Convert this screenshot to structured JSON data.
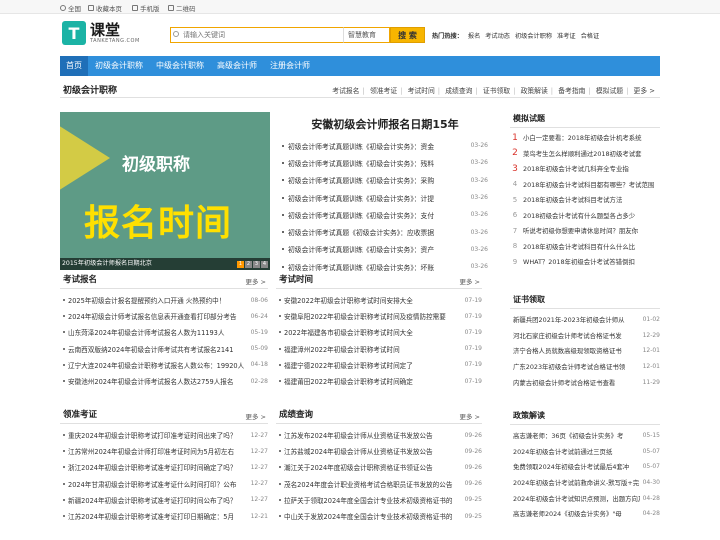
{
  "topbar": {
    "site": "全国",
    "fav": "收藏本页",
    "mobile": "手机版",
    "qr": "二维码"
  },
  "logo": {
    "cn": "课堂",
    "en": "TANKETANG.COM",
    "mark": "T"
  },
  "search": {
    "placeholder": "请输入关键词",
    "select": "智慧教育",
    "button": "搜 索"
  },
  "hot": {
    "label": "热门",
    "suffix": "热搜：",
    "items": [
      "报名",
      "考试动态",
      "初级会计职称",
      "准考证",
      "合格证"
    ]
  },
  "nav": [
    "首页",
    "初级会计职称",
    "中级会计职称",
    "高级会计师",
    "注册会计师"
  ],
  "sub": {
    "title": "初级会计职称",
    "links": [
      "考试报名",
      "领准考证",
      "考试时间",
      "成绩查询",
      "证书领取",
      "政策解读",
      "备考指南",
      "模拟试题",
      "更多 >"
    ]
  },
  "banner": {
    "line1": "初级职称",
    "line2": "报名时间",
    "caption": "2015年初级会计师报名日期北京",
    "dots": [
      "1",
      "2",
      "3",
      "4"
    ]
  },
  "headline": "安徽初级会计师报名日期15年",
  "hl": [
    {
      "t": "初级会计师考试真题训练《初级会计实务》：资金",
      "d": "03-26"
    },
    {
      "t": "初级会计师考试真题训练《初级会计实务》：残料",
      "d": "03-26"
    },
    {
      "t": "初级会计师考试真题训练《初级会计实务》：采购",
      "d": "03-26"
    },
    {
      "t": "初级会计师考试真题训练《初级会计实务》：计提",
      "d": "03-26"
    },
    {
      "t": "初级会计师考试真题训练《初级会计实务》：支付",
      "d": "03-26"
    },
    {
      "t": "初级会计师考试真题《初级会计实务》：应收票据",
      "d": "03-26"
    },
    {
      "t": "初级会计师考试真题训练《初级会计实务》：资产",
      "d": "03-26"
    },
    {
      "t": "初级会计师考试真题训练《初级会计实务》：坏账",
      "d": "03-26"
    }
  ],
  "sec1": {
    "title": "考试报名",
    "more": "更多 >",
    "items": [
      {
        "t": "2025年初级会计报名提醒预约入口开通 火热预约中！",
        "d": "08-06"
      },
      {
        "t": "2024年初级会计师考试报名信息表开通查看打印部分考告",
        "d": "06-24"
      },
      {
        "t": "山东菏泽2024年初级会计师考试报名人数为11193人",
        "d": "05-19"
      },
      {
        "t": "云南西双版纳2024年初级会计师考试共有考试报名2141",
        "d": "05-09"
      },
      {
        "t": "辽宁大连2024年初级会计职称考试报名人数公布：19920人",
        "d": "04-18"
      },
      {
        "t": "安徽池州2024年初级会计师考试报名人数达2759人报名",
        "d": "02-28"
      }
    ]
  },
  "sec2": {
    "title": "考试时间",
    "more": "更多 >",
    "items": [
      {
        "t": "安徽2022年初级会计职称考试时间安排大全",
        "d": "07-19"
      },
      {
        "t": "安徽阜阳2022年初级会计职称考试时间及疫情防控需要",
        "d": "07-19"
      },
      {
        "t": "2022年福建各市初级会计职称考试时间大全",
        "d": "07-19"
      },
      {
        "t": "福建漳州2022年初级会计职称考试时间",
        "d": "07-19"
      },
      {
        "t": "福建宁德2022年初级会计职称考试时间定了",
        "d": "07-19"
      },
      {
        "t": "福建莆田2022年初级会计职称考试时间确定",
        "d": "07-19"
      }
    ]
  },
  "sec3": {
    "title": "领准考证",
    "more": "更多 >",
    "items": [
      {
        "t": "重庆2024年初级会计职称考试打印准考证时间出来了吗？",
        "d": "12-27"
      },
      {
        "t": "江苏常州2024年初级会计师打印准考证时间为5月初左右",
        "d": "12-27"
      },
      {
        "t": "浙江2024年初级会计职称考试准考证打印时间确定了吗？",
        "d": "12-27"
      },
      {
        "t": "2024年甘肃初级会计职称考试准考证什么时间打印？公布",
        "d": "12-27"
      },
      {
        "t": "新疆2024年初级会计职称考试准考证打印时间公布了吗？",
        "d": "12-27"
      },
      {
        "t": "江苏2024年初级会计职称考试准考证打印日期确定：5月",
        "d": "12-21"
      }
    ]
  },
  "sec4": {
    "title": "成绩查询",
    "more": "更多 >",
    "items": [
      {
        "t": "江苏发布2024年初级会计师从业资格证书发放公告",
        "d": "09-26"
      },
      {
        "t": "江苏盐城2024年初级会计师从业资格证书发放公告",
        "d": "09-26"
      },
      {
        "t": "潮江关于2024年度初级会计职称资格证书领证公告",
        "d": "09-26"
      },
      {
        "t": "茂名2024年度会计职业资格考试合格职员证书发放的公告",
        "d": "09-26"
      },
      {
        "t": "拉萨关于领取2024年度全国会计专业技术初级资格证书的",
        "d": "09-25"
      },
      {
        "t": "中山关于发放2024年度全国会计专业技术初级资格证书的",
        "d": "09-25"
      }
    ]
  },
  "rank": {
    "title": "模拟试题",
    "items": [
      {
        "n": "1",
        "t": "小白一定要看：2018年初级会计机考系统"
      },
      {
        "n": "2",
        "t": "菜鸟考生怎么样顺利通过2018初级考试套"
      },
      {
        "n": "3",
        "t": "2018年初级会计考试几科弃全专业指"
      },
      {
        "n": "4",
        "t": "2018年初级会计考试科目都有哪些？考试范围"
      },
      {
        "n": "5",
        "t": "2018年初级会计考试科目考试方法"
      },
      {
        "n": "6",
        "t": "2018初级会计考试有什么题型各占多少"
      },
      {
        "n": "7",
        "t": "听说考初级你想要申请休息时间？朋友你"
      },
      {
        "n": "8",
        "t": "2018年初级会计考试科目有什么什么比"
      },
      {
        "n": "9",
        "t": "WHAT？2018年初级会计考试答错倒扣"
      }
    ]
  },
  "cert": {
    "title": "证书领取",
    "items": [
      {
        "t": "新疆兵团2021年-2023年初级会计师从",
        "d": "01-02"
      },
      {
        "t": "河北石家庄初级会计师考试合格证书发",
        "d": "12-29"
      },
      {
        "t": "济宁合格人员就数高级现领取资格证书",
        "d": "12-01"
      },
      {
        "t": "广东2023年初级会计师考试合格证书领",
        "d": "12-01"
      },
      {
        "t": "内蒙古初级会计师考试合格证书查看",
        "d": "11-29"
      }
    ]
  },
  "policy": {
    "title": "政策解读",
    "items": [
      {
        "t": "高志谦老师：36页《初级会计实务》考",
        "d": "05-15"
      },
      {
        "t": "2024年初级会计考试前通过三页纸",
        "d": "05-07"
      },
      {
        "t": "免费领取2024年初级会计考试最后4套冲",
        "d": "05-07"
      },
      {
        "t": "2024年初级会计考试前救命讲义-默写版+完",
        "d": "04-30"
      },
      {
        "t": "2024年初级会计考试知识点预测，出题方向及",
        "d": "04-28"
      },
      {
        "t": "高志谦老师2024《初级会计实务》\"母",
        "d": "04-28"
      }
    ]
  }
}
